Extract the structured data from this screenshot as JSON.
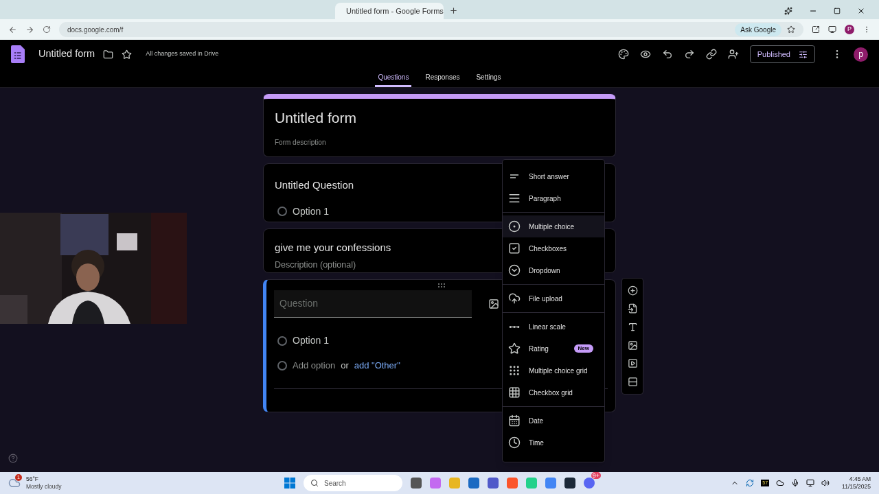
{
  "browser": {
    "tab": {
      "title": "Untitled form - Google Forms",
      "selected": true
    },
    "address": "docs.google.com/f",
    "ask_google": "Ask Google",
    "avatar": "P"
  },
  "app": {
    "title": "Untitled form",
    "save_status": "All changes saved in Drive",
    "publish_button": "Published",
    "avatar": "p"
  },
  "nav_tabs": [
    {
      "label": "Questions",
      "selected": true
    },
    {
      "label": "Responses",
      "selected": false
    },
    {
      "label": "Settings",
      "selected": false
    }
  ],
  "form": {
    "title": "Untitled form",
    "description": "Form description"
  },
  "questions": [
    {
      "kind": "choice",
      "title": "Untitled Question",
      "options": [
        {
          "label": "Option 1",
          "selected": false
        }
      ]
    },
    {
      "kind": "section",
      "title": "give me your confessions",
      "description": "Description (optional)"
    },
    {
      "kind": "editing",
      "placeholder": "Question",
      "options": [
        {
          "label": "Option 1",
          "selected": false
        }
      ],
      "add_option": "Add option",
      "add_option_selected": false,
      "or": "or",
      "add_other": "add \"Other\""
    }
  ],
  "type_menu": [
    [
      {
        "label": "Short answer",
        "kind": "short",
        "selected": false
      },
      {
        "label": "Paragraph",
        "kind": "paragraph",
        "selected": false
      }
    ],
    [
      {
        "label": "Multiple choice",
        "kind": "radio",
        "selected": true
      },
      {
        "label": "Checkboxes",
        "kind": "check",
        "selected": false
      },
      {
        "label": "Dropdown",
        "kind": "dropdown",
        "selected": false
      }
    ],
    [
      {
        "label": "File upload",
        "kind": "upload",
        "selected": false
      }
    ],
    [
      {
        "label": "Linear scale",
        "kind": "scale",
        "selected": false
      },
      {
        "label": "Rating",
        "kind": "star",
        "selected": false,
        "badge": "New"
      },
      {
        "label": "Multiple choice grid",
        "kind": "dotgrid",
        "selected": false
      },
      {
        "label": "Checkbox grid",
        "kind": "squaregrid",
        "selected": false
      }
    ],
    [
      {
        "label": "Date",
        "kind": "date",
        "selected": false
      },
      {
        "label": "Time",
        "kind": "time",
        "selected": false
      }
    ]
  ],
  "taskbar": {
    "weather": {
      "temp": "56°F",
      "condition": "Mostly cloudy",
      "alerts": "1"
    },
    "search": "Search",
    "tray_badge": "57",
    "discord_badge": "9+",
    "time": "4:45 AM",
    "date": "11/15/2025"
  }
}
